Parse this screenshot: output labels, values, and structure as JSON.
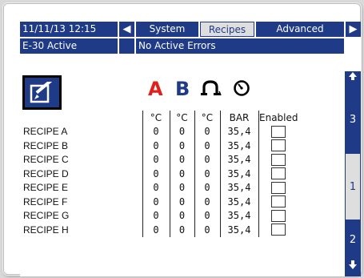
{
  "header": {
    "datetime": "11/11/13 12:15",
    "nav_left": "◀",
    "nav_right": "▶",
    "tabs": [
      {
        "label": "System",
        "selected": false
      },
      {
        "label": "Recipes",
        "selected": true
      },
      {
        "label": "Advanced",
        "selected": false
      }
    ]
  },
  "status": {
    "mode": "E-30 Active",
    "errors": "No Active Errors"
  },
  "side_nav": {
    "up_icon": "arrow-up-icon",
    "down_icon": "arrow-down-icon",
    "pages": [
      "3",
      "1",
      "2"
    ],
    "selected_page": "1"
  },
  "edit_button": {
    "icon": "edit-pencil-icon"
  },
  "columns": {
    "a_letter": "A",
    "b_letter": "B",
    "hose_icon": "hose-heat-icon",
    "pressure_icon": "pressure-gauge-icon",
    "units": [
      "°C",
      "°C",
      "°C",
      "BAR",
      "Enabled"
    ]
  },
  "recipes": [
    {
      "name": "RECIPE A",
      "a": "0",
      "b": "0",
      "hose": "0",
      "pressure": "35,4",
      "enabled": false
    },
    {
      "name": "RECIPE B",
      "a": "0",
      "b": "0",
      "hose": "0",
      "pressure": "35,4",
      "enabled": false
    },
    {
      "name": "RECIPE C",
      "a": "0",
      "b": "0",
      "hose": "0",
      "pressure": "35,4",
      "enabled": false
    },
    {
      "name": "RECIPE D",
      "a": "0",
      "b": "0",
      "hose": "0",
      "pressure": "35,4",
      "enabled": false
    },
    {
      "name": "RECIPE E",
      "a": "0",
      "b": "0",
      "hose": "0",
      "pressure": "35,4",
      "enabled": false
    },
    {
      "name": "RECIPE F",
      "a": "0",
      "b": "0",
      "hose": "0",
      "pressure": "35,4",
      "enabled": false
    },
    {
      "name": "RECIPE G",
      "a": "0",
      "b": "0",
      "hose": "0",
      "pressure": "35,4",
      "enabled": false
    },
    {
      "name": "RECIPE H",
      "a": "0",
      "b": "0",
      "hose": "0",
      "pressure": "35,4",
      "enabled": false
    }
  ],
  "colors": {
    "navy": "#1f3a86",
    "tab_selected_bg": "#dedede",
    "a_red": "#e0201a",
    "b_blue": "#1f3a86"
  }
}
